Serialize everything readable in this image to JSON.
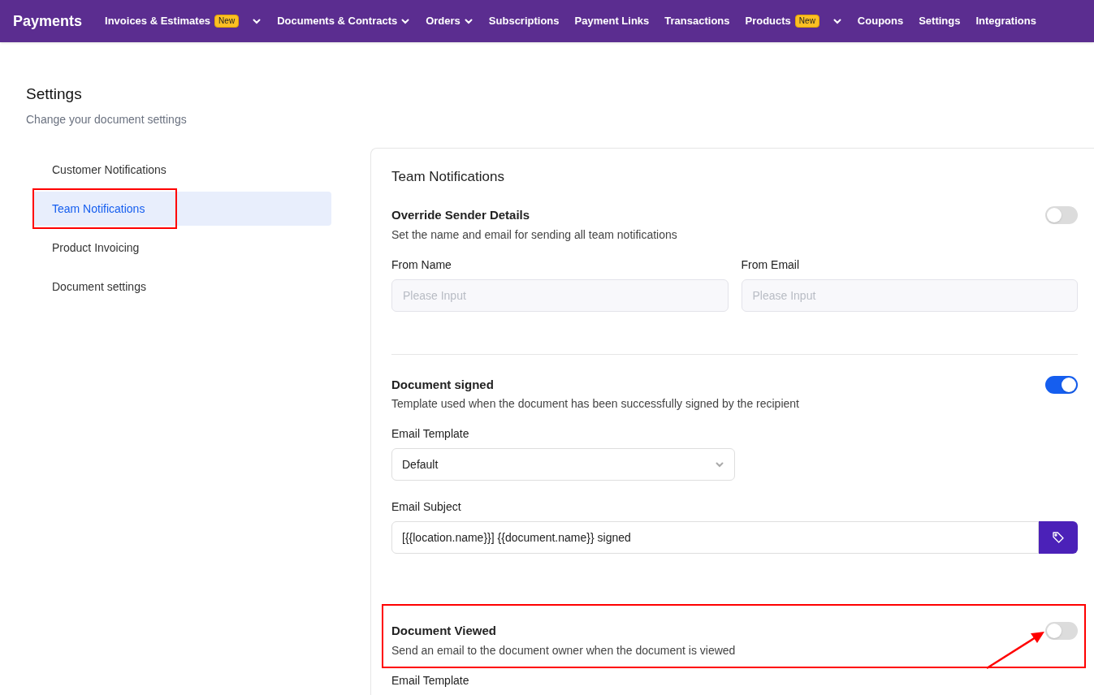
{
  "nav": {
    "brand": "Payments",
    "items": [
      {
        "label": "Invoices & Estimates",
        "badge": "New",
        "dropdown": true
      },
      {
        "label": "Documents & Contracts",
        "dropdown": true
      },
      {
        "label": "Orders",
        "dropdown": true
      },
      {
        "label": "Subscriptions"
      },
      {
        "label": "Payment Links"
      },
      {
        "label": "Transactions"
      },
      {
        "label": "Products",
        "badge": "New",
        "dropdown": true
      },
      {
        "label": "Coupons"
      },
      {
        "label": "Settings"
      },
      {
        "label": "Integrations"
      }
    ]
  },
  "header": {
    "title": "Settings",
    "subtitle": "Change your document settings"
  },
  "sidebar": {
    "items": [
      {
        "label": "Customer Notifications",
        "selected": false
      },
      {
        "label": "Team Notifications",
        "selected": true,
        "highlighted": true
      },
      {
        "label": "Product Invoicing",
        "selected": false
      },
      {
        "label": "Document settings",
        "selected": false
      }
    ]
  },
  "panel": {
    "title": "Team Notifications",
    "sections": [
      {
        "title": "Override Sender Details",
        "description": "Set the name and email for sending all team notifications",
        "on": false,
        "divider_after": true,
        "fields": [
          {
            "kind": "text",
            "label": "From Name",
            "placeholder": "Please Input"
          },
          {
            "kind": "text",
            "label": "From Email",
            "placeholder": "Please Input"
          }
        ]
      },
      {
        "title": "Document signed",
        "description": "Template used when the document has been successfully signed by the recipient",
        "on": true,
        "fields": [
          {
            "kind": "select",
            "label": "Email Template",
            "value": "Default"
          },
          {
            "kind": "subject",
            "label": "Email Subject",
            "value": "[{{location.name}}] {{document.name}} signed"
          }
        ]
      },
      {
        "title": "Document Viewed",
        "description": "Send an email to the document owner when the document is viewed",
        "on": false,
        "highlighted": true,
        "fields": [
          {
            "kind": "label",
            "label": "Email Template"
          }
        ]
      }
    ]
  }
}
